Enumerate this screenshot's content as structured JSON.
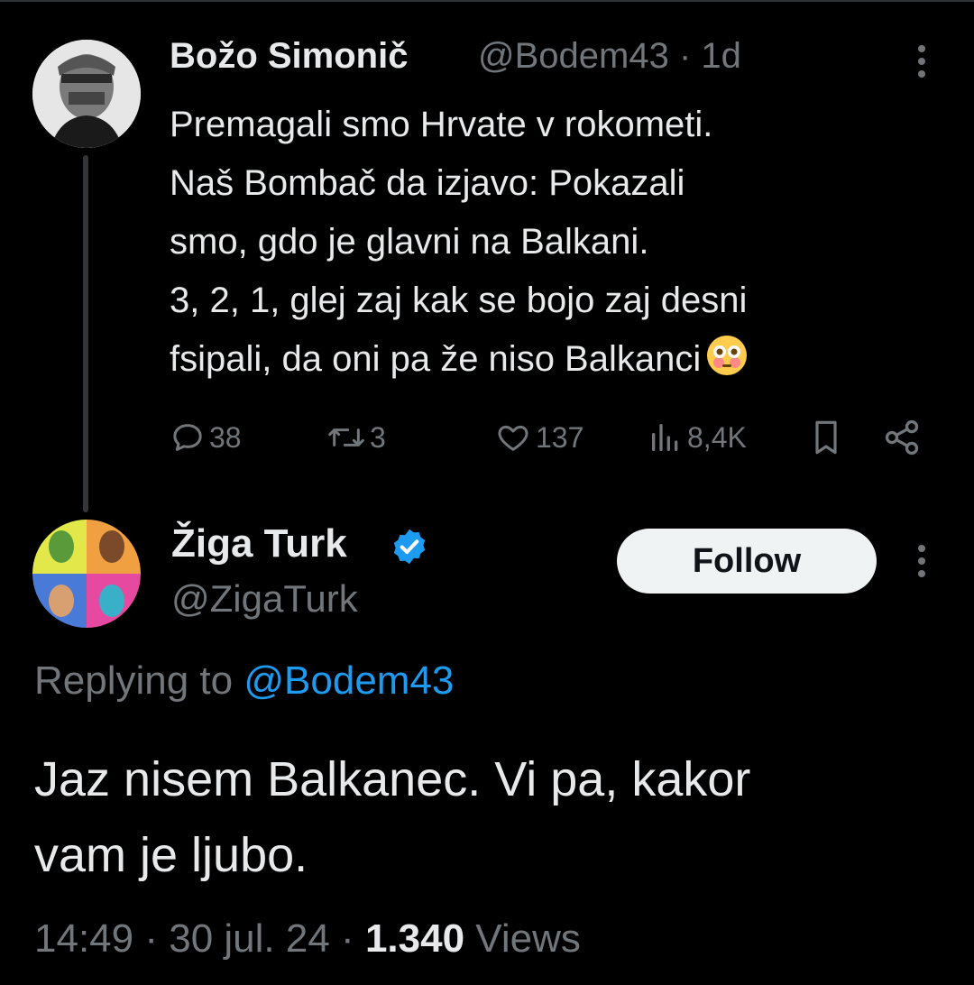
{
  "parent_tweet": {
    "display_name": "Božo Simonič",
    "handle": "@Bodem43",
    "separator": "·",
    "age": "1d",
    "text_lines": [
      "Premagali smo Hrvate v rokometi.",
      "Naš Bombač da izjavo: Pokazali",
      "smo, gdo je glavni na Balkani.",
      "3, 2, 1, glej zaj kak se bojo zaj desni",
      "fsipali, da oni pa že niso Balkanci"
    ],
    "emoji": "flushed-face-emoji",
    "actions": {
      "replies": "38",
      "reposts": "3",
      "likes": "137",
      "views": "8,4K"
    }
  },
  "reply_tweet": {
    "display_name": "Žiga Turk",
    "verified": true,
    "handle": "@ZigaTurk",
    "follow_label": "Follow",
    "replying_prefix": "Replying to",
    "replying_handle": "@Bodem43",
    "text_lines": [
      "Jaz nisem Balkanec. Vi pa, kakor",
      "vam je ljubo."
    ],
    "time": "14:49",
    "date": "30 jul. 24",
    "views_count": "1.340",
    "views_label": "Views",
    "separator": "·"
  },
  "colors": {
    "background": "#000000",
    "text_primary": "#e7e9ea",
    "text_secondary": "#71767b",
    "link": "#1d9bf0",
    "verified_badge": "#1d9bf0",
    "follow_button_bg": "#eff3f4"
  },
  "icons": [
    "reply-icon",
    "repost-icon",
    "like-icon",
    "views-icon",
    "bookmark-icon",
    "share-icon",
    "more-icon",
    "verified-badge-icon"
  ]
}
